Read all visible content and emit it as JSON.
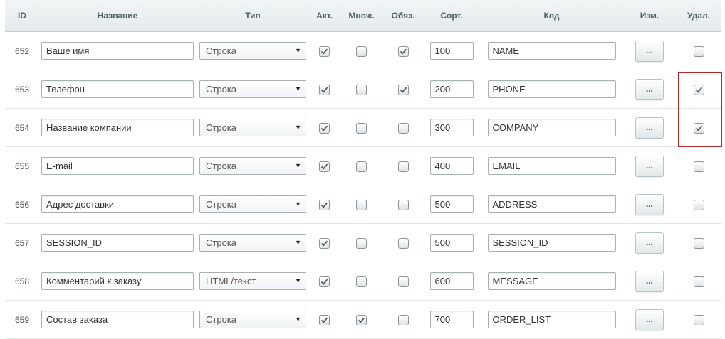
{
  "columns": {
    "id": "ID",
    "name": "Название",
    "type": "Тип",
    "active": "Акт.",
    "multiple": "Множ.",
    "required": "Обяз.",
    "sort": "Сорт.",
    "code": "Код",
    "edit": "Изм.",
    "delete": "Удал."
  },
  "edit_button_label": "...",
  "highlight_color": "#b4262c",
  "rows": [
    {
      "id": "652",
      "name": "Ваше имя",
      "type": "Строка",
      "active": true,
      "multiple": false,
      "required": true,
      "sort": "100",
      "code": "NAME",
      "delete": false
    },
    {
      "id": "653",
      "name": "Телефон",
      "type": "Строка",
      "active": true,
      "multiple": false,
      "required": true,
      "sort": "200",
      "code": "PHONE",
      "delete": true
    },
    {
      "id": "654",
      "name": "Название компании",
      "type": "Строка",
      "active": true,
      "multiple": false,
      "required": false,
      "sort": "300",
      "code": "COMPANY",
      "delete": true
    },
    {
      "id": "655",
      "name": "E-mail",
      "type": "Строка",
      "active": true,
      "multiple": false,
      "required": false,
      "sort": "400",
      "code": "EMAIL",
      "delete": false
    },
    {
      "id": "656",
      "name": "Адрес доставки",
      "type": "Строка",
      "active": true,
      "multiple": false,
      "required": false,
      "sort": "500",
      "code": "ADDRESS",
      "delete": false
    },
    {
      "id": "657",
      "name": "SESSION_ID",
      "type": "Строка",
      "active": true,
      "multiple": false,
      "required": false,
      "sort": "500",
      "code": "SESSION_ID",
      "delete": false
    },
    {
      "id": "658",
      "name": "Комментарий к заказу",
      "type": "HTML/текст",
      "active": true,
      "multiple": false,
      "required": false,
      "sort": "600",
      "code": "MESSAGE",
      "delete": false
    },
    {
      "id": "659",
      "name": "Состав заказа",
      "type": "Строка",
      "active": true,
      "multiple": true,
      "required": false,
      "sort": "700",
      "code": "ORDER_LIST",
      "delete": false
    }
  ]
}
